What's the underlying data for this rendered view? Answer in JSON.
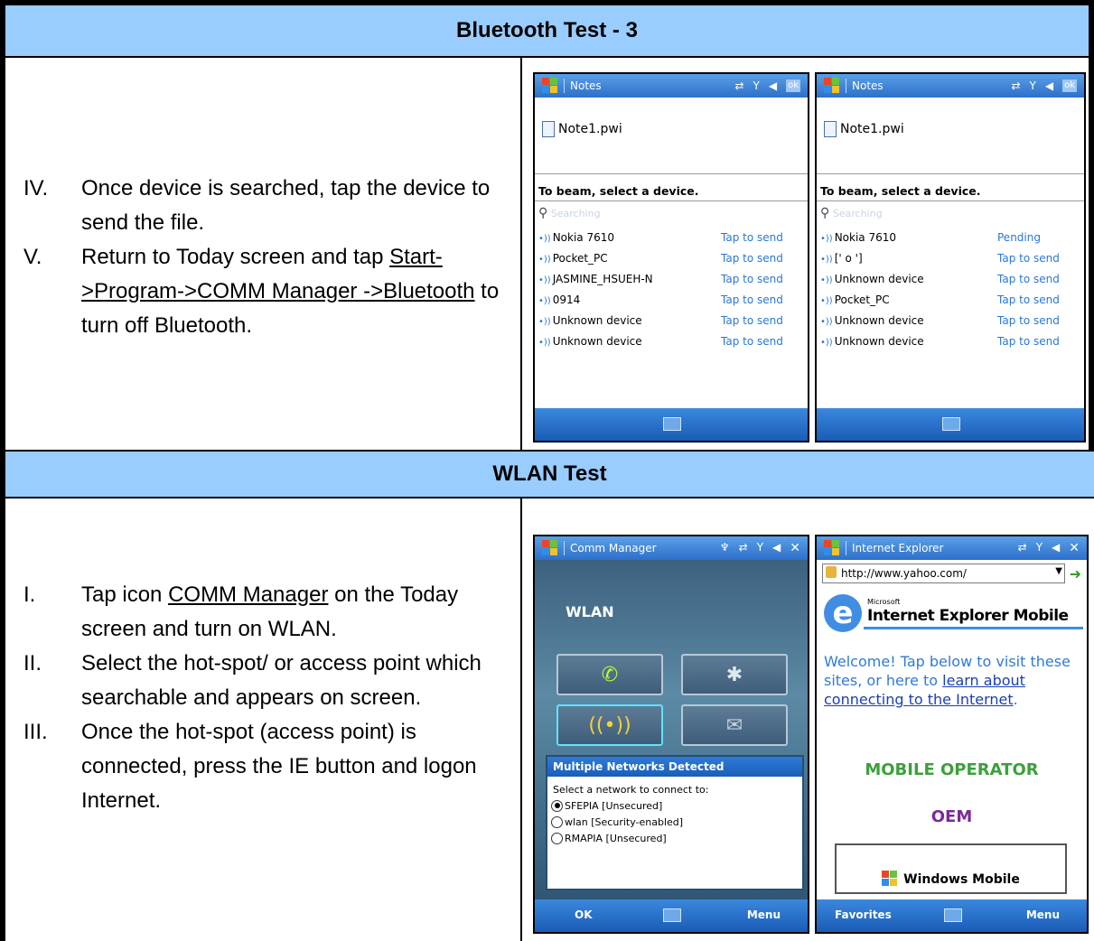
{
  "sections": {
    "bluetooth": {
      "title": "Bluetooth Test - 3",
      "steps": [
        {
          "num": "IV.",
          "text": "Once device is searched, tap the device to send the file."
        },
        {
          "num": "V.",
          "text_before": "Return to Today screen and tap ",
          "link": "Start->Program->COMM Manager ->Bluetooth",
          "text_after": " to turn off Bluetooth."
        }
      ]
    },
    "wlan": {
      "title": "WLAN Test",
      "steps": [
        {
          "num": "I.",
          "text_before": "Tap icon ",
          "link": "COMM Manager",
          "text_after": " on the Today screen and turn on WLAN."
        },
        {
          "num": "II.",
          "text": "Select the hot-spot/ or access point which searchable and appears on screen."
        },
        {
          "num": "III.",
          "text": "Once the hot-spot (access point) is connected, press the IE button and logon Internet."
        }
      ]
    }
  },
  "screens": {
    "notes1": {
      "title": "Notes",
      "file": "Note1.pwi",
      "beam_prompt": "To beam, select a device.",
      "searching": "Searching",
      "devices": [
        {
          "name": "Nokia 7610",
          "status": "Tap to send"
        },
        {
          "name": "Pocket_PC",
          "status": "Tap to send"
        },
        {
          "name": "JASMINE_HSUEH-N",
          "status": "Tap to send"
        },
        {
          "name": "0914",
          "status": "Tap to send"
        },
        {
          "name": "Unknown device",
          "status": "Tap to send"
        },
        {
          "name": "Unknown device",
          "status": "Tap to send"
        }
      ]
    },
    "notes2": {
      "title": "Notes",
      "file": "Note1.pwi",
      "beam_prompt": "To beam, select a device.",
      "searching": "Searching",
      "devices": [
        {
          "name": "Nokia 7610",
          "status": "Pending"
        },
        {
          "name": "[' o ']",
          "status": "Tap to send"
        },
        {
          "name": "Unknown device",
          "status": "Tap to send"
        },
        {
          "name": "Pocket_PC",
          "status": "Tap to send"
        },
        {
          "name": "Unknown device",
          "status": "Tap to send"
        },
        {
          "name": "Unknown device",
          "status": "Tap to send"
        }
      ]
    },
    "comm": {
      "title": "Comm Manager",
      "heading": "WLAN",
      "dialog_title": "Multiple Networks Detected",
      "dialog_prompt": "Select a network to connect to:",
      "networks": [
        "SFEPIA [Unsecured]",
        "wlan [Security-enabled]",
        "RMAPIA [Unsecured]"
      ],
      "left_soft": "OK",
      "right_soft": "Menu"
    },
    "ie": {
      "title": "Internet Explorer",
      "url": "http://www.yahoo.com/",
      "brand_small": "Microsoft",
      "brand": "Internet Explorer Mobile",
      "welcome_before": "Welcome! Tap below to visit these sites, or here to ",
      "welcome_link": "learn about connecting to the Internet",
      "welcome_after": ".",
      "operator": "MOBILE OPERATOR",
      "oem": "OEM",
      "wm": "Windows Mobile",
      "left_soft": "Favorites",
      "right_soft": "Menu"
    }
  },
  "status_icons": [
    "connectivity-icon",
    "signal-icon",
    "volume-icon"
  ],
  "ok_label": "ok",
  "close_label": "✕"
}
